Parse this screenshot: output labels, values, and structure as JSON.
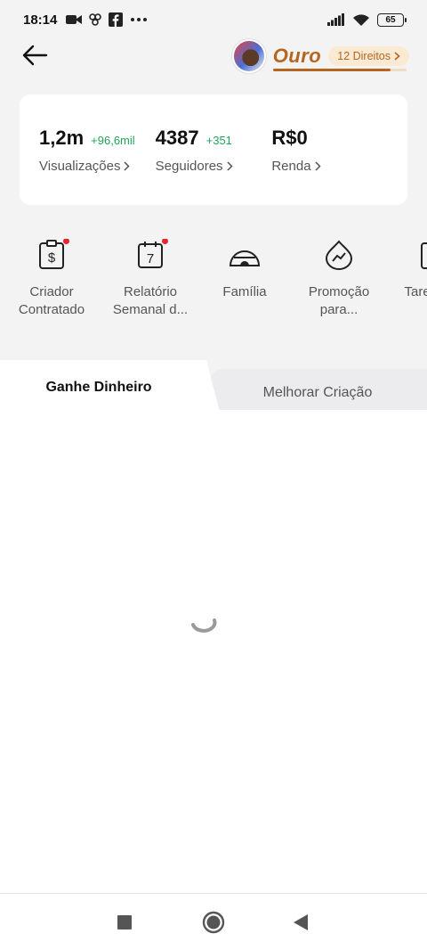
{
  "status_bar": {
    "time": "18:14",
    "left_icons": [
      "video-camera-icon",
      "link-icon",
      "facebook-icon",
      "more-dots-icon"
    ],
    "battery": "65",
    "right_icons": [
      "signal-icon",
      "wifi-icon",
      "battery-icon"
    ]
  },
  "header": {
    "back_icon": "arrow-left-icon",
    "tier_name": "Ouro",
    "tier_badge": "12 Direitos",
    "tier_progress": 0.88
  },
  "stats": [
    {
      "value": "1,2m",
      "delta": "+96,6mil",
      "label": "Visualizações"
    },
    {
      "value": "4387",
      "delta": "+351",
      "label": "Seguidores"
    },
    {
      "value": "R$0",
      "delta": "",
      "label": "Renda"
    }
  ],
  "tools": [
    {
      "label": "Criador Contratado",
      "icon": "contract-dollar-icon",
      "has_dot": true
    },
    {
      "label": "Relatório Semanal d...",
      "icon": "calendar-7-icon",
      "has_dot": true
    },
    {
      "label": "Família",
      "icon": "igloo-icon",
      "has_dot": false
    },
    {
      "label": "Promoção para...",
      "icon": "promotion-trend-icon",
      "has_dot": false
    },
    {
      "label": "Taref Cria",
      "icon": "task-icon",
      "has_dot": false
    }
  ],
  "tabs": {
    "earn": "Ganhe Dinheiro",
    "improve": "Melhorar Criação"
  },
  "colors": {
    "accent_gold": "#b5651d",
    "delta_green": "#22a35a",
    "dot_red": "#e8252f"
  }
}
